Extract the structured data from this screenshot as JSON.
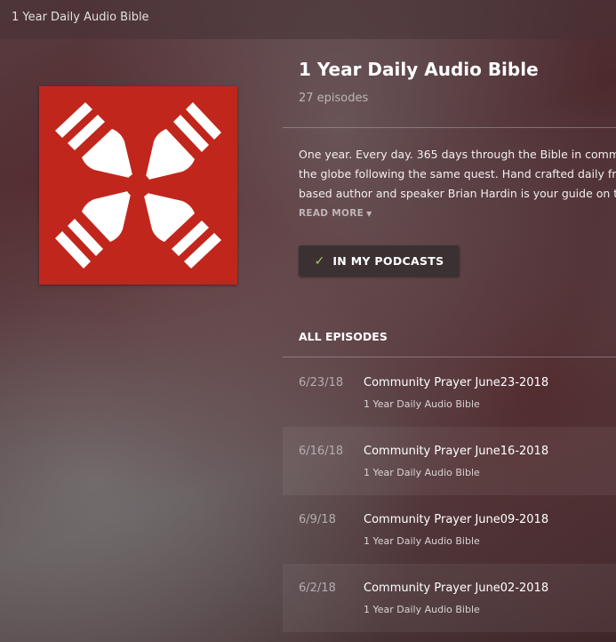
{
  "window": {
    "title": "1 Year Daily Audio Bible"
  },
  "podcast": {
    "title": "1 Year Daily Audio Bible",
    "episode_count": "27 episodes",
    "description_lines": [
      "One year. Every day. 365 days through the Bible in commu",
      "the globe following the same quest. Hand crafted daily fro",
      "based author and speaker Brian Hardin is your guide on t"
    ],
    "read_more_label": "READ MORE",
    "subscribe_label": "IN MY PODCASTS",
    "artwork_color": "#c1261c"
  },
  "episodes_section": {
    "heading": "ALL EPISODES",
    "items": [
      {
        "date": "6/23/18",
        "title": "Community Prayer June23-2018",
        "podcast": "1 Year Daily Audio Bible"
      },
      {
        "date": "6/16/18",
        "title": "Community Prayer June16-2018",
        "podcast": "1 Year Daily Audio Bible"
      },
      {
        "date": "6/9/18",
        "title": "Community Prayer June09-2018",
        "podcast": "1 Year Daily Audio Bible"
      },
      {
        "date": "6/2/18",
        "title": "Community Prayer June02-2018",
        "podcast": "1 Year Daily Audio Bible"
      }
    ]
  },
  "colors": {
    "accent_check": "#a8cf5a",
    "button_bg": "#3b3132"
  }
}
